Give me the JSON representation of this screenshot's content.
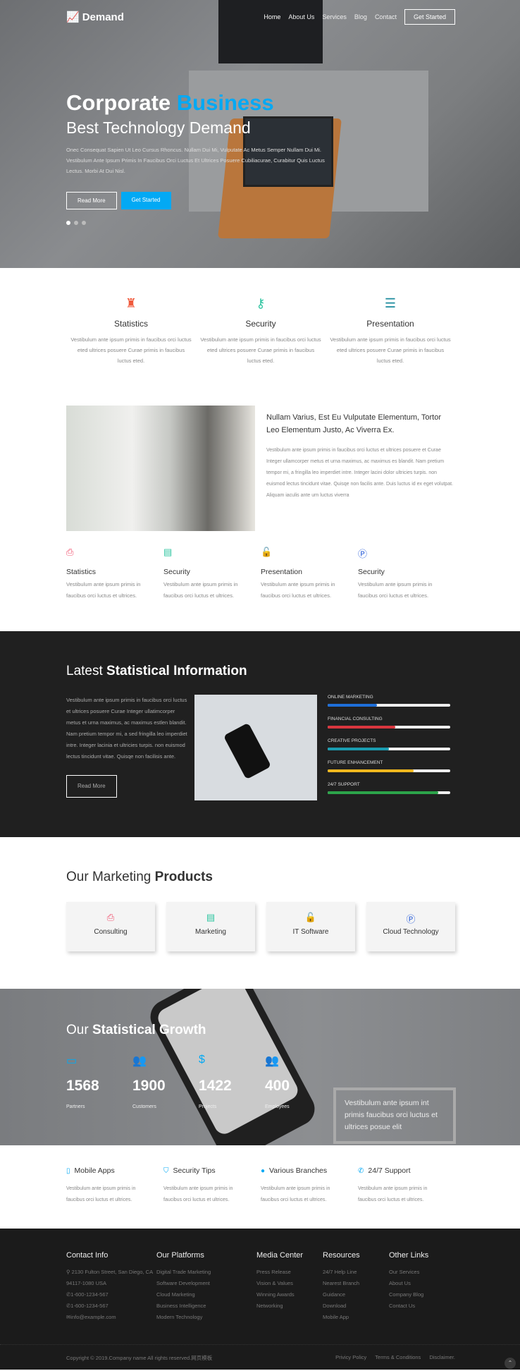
{
  "nav": {
    "logo": "Demand",
    "items": [
      "Home",
      "About Us",
      "Services",
      "Blog",
      "Contact"
    ],
    "cta": "Get Started"
  },
  "hero": {
    "title_a": "Corporate",
    "title_b": "Business",
    "subtitle": "Best Technology Demand",
    "text": "Onec Consequat Sapien Ut Leo Cursus Rhoncus. Nullam Dui Mi, Vulputate Ac Metus Semper Nullam Dui Mi. Vestibulum Ante Ipsum Primis In Faucibus Orci Luctus Et Ultrices Posuere Cubiliacurae, Curabitur Quis Luctus Lectus. Morbi At Dui Nisl.",
    "read_more": "Read More",
    "get_started": "Get Started",
    "accent": "#03a9f4",
    "slides": 3,
    "active_slide": 1
  },
  "features": [
    {
      "icon": "castle-icon",
      "color": "#f05a3c",
      "title": "Statistics",
      "text": "Vestibulum ante ipsum primis in faucibus orci luctus eted ultrices posuere Curae primis in faucibus luctus eted."
    },
    {
      "icon": "key-icon",
      "color": "#2ec4a0",
      "title": "Security",
      "text": "Vestibulum ante ipsum primis in faucibus orci luctus eted ultrices posuere Curae primis in faucibus luctus eted."
    },
    {
      "icon": "server-icon",
      "color": "#1a8a9c",
      "title": "Presentation",
      "text": "Vestibulum ante ipsum primis in faucibus orci luctus eted ultrices posuere Curae primis in faucibus luctus eted."
    }
  ],
  "about": {
    "heading": "Nullam Varius, Est Eu Vulputate Elementum, Tortor Leo Elementum Justo, Ac Viverra Ex.",
    "text": "Vestibulum ante ipsum primis in faucibus orci luctus et ultrices posuere et Curae Integer ullamcorper metus et urna maximus, ac maximus es blandit. Nam pretium tempor mi, a fringilla leo imperdiet intre. Integer lacini dolor ultricies turpis. non euismod lectus tincidunt vitae. Quisqe non facilis ante. Duis luctus id ex eget volutpat. Aliquam iaculis ante urn luctus viverra"
  },
  "features4": [
    {
      "icon": "printer-icon",
      "color": "#f0506e",
      "title": "Statistics",
      "text": "Vestibulum ante ipsum primis in faucibus orci luctus et ultrices."
    },
    {
      "icon": "newspaper-icon",
      "color": "#2ec4a0",
      "title": "Security",
      "text": "Vestibulum ante ipsum primis in faucibus orci luctus et ultrices."
    },
    {
      "icon": "unlock-icon",
      "color": "#1aa0c4",
      "title": "Presentation",
      "text": "Vestibulum ante ipsum primis in faucibus orci luctus et ultrices."
    },
    {
      "icon": "parking-icon",
      "color": "#2b5fd9",
      "title": "Security",
      "text": "Vestibulum ante ipsum primis in faucibus orci luctus et ultrices."
    }
  ],
  "stats_info": {
    "title_a": "Latest",
    "title_b": "Statistical Information",
    "text": "Vestibulum ante ipsum primis in faucibus orci luctus et ultrices posuere Curae Integer ullatimcorper metus et urna maximus, ac maximus estlen blandit. Nam pretium tempor mi, a sed fringilla leo imperdiet intre. Integer lacinia et ultricies turpis. non euismod lectus tincidunt vitae. Quisqe non facilisis ante.",
    "read_more": "Read More",
    "bars": [
      {
        "label": "ONLINE MARKETING",
        "percent": 40,
        "color": "#1e6fd9"
      },
      {
        "label": "FINANCIAL CONSULTING",
        "percent": 55,
        "color": "#d9363e"
      },
      {
        "label": "CREATIVE PROJECTS",
        "percent": 50,
        "color": "#1a9cb0"
      },
      {
        "label": "FUTURE ENHANCEMENT",
        "percent": 70,
        "color": "#f0b81e"
      },
      {
        "label": "24/7 SUPPORT",
        "percent": 90,
        "color": "#2ca44a"
      }
    ]
  },
  "products": {
    "title_a": "Our Marketing",
    "title_b": "Products",
    "items": [
      {
        "icon": "printer-icon",
        "color": "#f0506e",
        "label": "Consulting"
      },
      {
        "icon": "newspaper-icon",
        "color": "#2ec4a0",
        "label": "Marketing"
      },
      {
        "icon": "unlock-icon",
        "color": "#1aa0c4",
        "label": "IT Software"
      },
      {
        "icon": "parking-icon",
        "color": "#2b5fd9",
        "label": "Cloud Technology"
      }
    ]
  },
  "growth": {
    "title_a": "Our",
    "title_b": "Statistical Growth",
    "stats": [
      {
        "icon": "credit-card-icon",
        "value": "1568",
        "label": "Partners"
      },
      {
        "icon": "users-icon",
        "value": "1900",
        "label": "Customers"
      },
      {
        "icon": "dollar-icon",
        "value": "1422",
        "label": "Projects"
      },
      {
        "icon": "users-icon",
        "value": "400",
        "label": "Employees"
      }
    ],
    "box_text": "Vestibulum ante ipsum int primis faucibus orci luctus et ultrices posue elit"
  },
  "services": [
    {
      "icon": "mobile-icon",
      "title": "Mobile Apps",
      "text": "Vestibulum ante ipsum primis in faucibus orci luctus et ultrices."
    },
    {
      "icon": "shield-icon",
      "title": "Security Tips",
      "text": "Vestibulum ante ipsum primis in faucibus orci luctus et ultrices."
    },
    {
      "icon": "globe-icon",
      "title": "Various Branches",
      "text": "Vestibulum ante ipsum primis in faucibus orci luctus et ultrices."
    },
    {
      "icon": "phone-icon",
      "title": "24/7 Support",
      "text": "Vestibulum ante ipsum primis in faucibus orci luctus et ultrices."
    }
  ],
  "footer": {
    "contact": {
      "title": "Contact Info",
      "address": "2130 Fulton Street, San Diego, CA 94117-1080 USA",
      "phone1": "1-600-1234-567",
      "phone2": "1-600-1234-567",
      "email": "info@example.com"
    },
    "cols": [
      {
        "title": "Our Platforms",
        "links": [
          "Digital Trade Marketing",
          "Software Development",
          "Cloud Marketing",
          "Business Intelligence",
          "Modern Technology"
        ]
      },
      {
        "title": "Media Center",
        "links": [
          "Press Release",
          "Vision & Values",
          "Winning Awards",
          "Networking"
        ]
      },
      {
        "title": "Resources",
        "links": [
          "24/7 Help Line",
          "Nearest Branch",
          "Guidance",
          "Download",
          "Mobile App"
        ]
      },
      {
        "title": "Other Links",
        "links": [
          "Our Services",
          "About Us",
          "Company Blog",
          "Contact Us"
        ]
      }
    ],
    "copyright": "Copyright © 2019.Company name All rights reserved.网页模板",
    "legal": [
      "Privicy Policy",
      "Terms & Conditions",
      "Disclaimer."
    ]
  }
}
